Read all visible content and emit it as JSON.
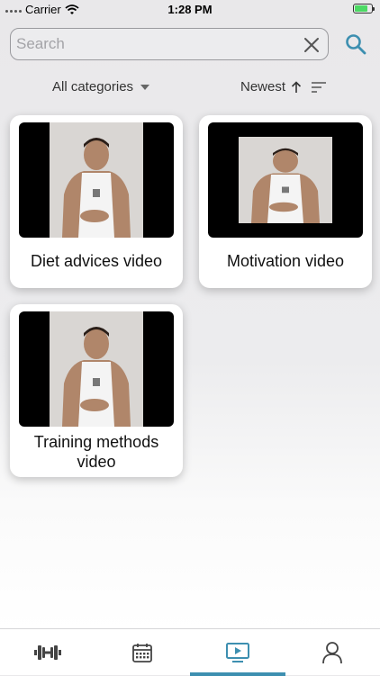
{
  "status_bar": {
    "carrier": "Carrier",
    "time": "1:28 PM",
    "battery_level": 0.8
  },
  "search": {
    "placeholder": "Search",
    "value": "",
    "clear_icon": "close-icon",
    "search_icon": "search-icon"
  },
  "filters": {
    "category": {
      "label": "All categories",
      "icon": "caret-down-icon"
    },
    "sort": {
      "label": "Newest",
      "icons": [
        "arrow-up-icon",
        "sort-icon"
      ]
    }
  },
  "videos": [
    {
      "title": "Diet advices video"
    },
    {
      "title": "Motivation video"
    },
    {
      "title": "Training methods video"
    }
  ],
  "tabs": [
    {
      "name": "workouts",
      "icon": "dumbbell-icon",
      "active": false
    },
    {
      "name": "calendar",
      "icon": "calendar-icon",
      "active": false
    },
    {
      "name": "videos",
      "icon": "play-icon",
      "active": true
    },
    {
      "name": "profile",
      "icon": "user-icon",
      "active": false
    }
  ],
  "colors": {
    "accent": "#3d8fb0",
    "battery": "#4cd964"
  }
}
